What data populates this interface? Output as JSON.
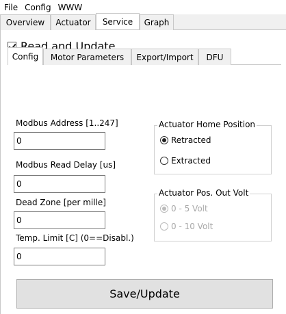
{
  "menu": {
    "items": [
      "File",
      "Config",
      "WWW"
    ]
  },
  "top_tabs": {
    "items": [
      "Overview",
      "Actuator",
      "Service",
      "Graph"
    ],
    "active": "Service"
  },
  "read_update": {
    "label": "Read and Update",
    "checked": true
  },
  "sub_tabs": {
    "items": [
      "Config",
      "Motor Parameters",
      "Export/Import",
      "DFU"
    ],
    "active": "Config"
  },
  "fields": {
    "modbus_address": {
      "label": "Modbus Address [1..247]",
      "value": "0"
    },
    "modbus_read_delay": {
      "label": "Modbus Read Delay [us]",
      "value": "0"
    },
    "dead_zone": {
      "label": "Dead Zone [per mille]",
      "value": "0"
    },
    "temp_limit": {
      "label": "Temp. Limit [C] (0==Disabl.)",
      "value": "0"
    }
  },
  "home_position": {
    "title": "Actuator Home Position",
    "options": [
      "Retracted",
      "Extracted"
    ],
    "selected": "Retracted"
  },
  "pos_out_volt": {
    "title": "Actuator Pos. Out Volt",
    "options": [
      "0 - 5 Volt",
      "0 - 10 Volt"
    ],
    "selected": "0 - 5 Volt",
    "disabled": true
  },
  "save_button": {
    "label": "Save/Update"
  }
}
